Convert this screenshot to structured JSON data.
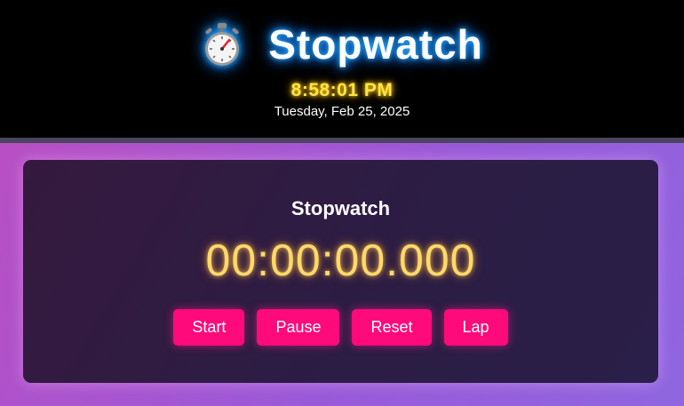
{
  "header": {
    "icon": "stopwatch-icon",
    "title": "Stopwatch",
    "clock_time": "8:58:01 PM",
    "clock_date": "Tuesday, Feb 25, 2025"
  },
  "stopwatch": {
    "title": "Stopwatch",
    "display": "00:00:00.000",
    "buttons": {
      "start": "Start",
      "pause": "Pause",
      "reset": "Reset",
      "lap": "Lap"
    }
  },
  "colors": {
    "header_background": "#000000",
    "title_glow": "#2fb4ff",
    "clock_time": "#ffe34a",
    "page_gradient_start": "#b94fc4",
    "page_gradient_end": "#8f66e0",
    "card_background": "#2b1d44",
    "display_text": "#ffd86b",
    "button_background": "#ff0a7a"
  }
}
